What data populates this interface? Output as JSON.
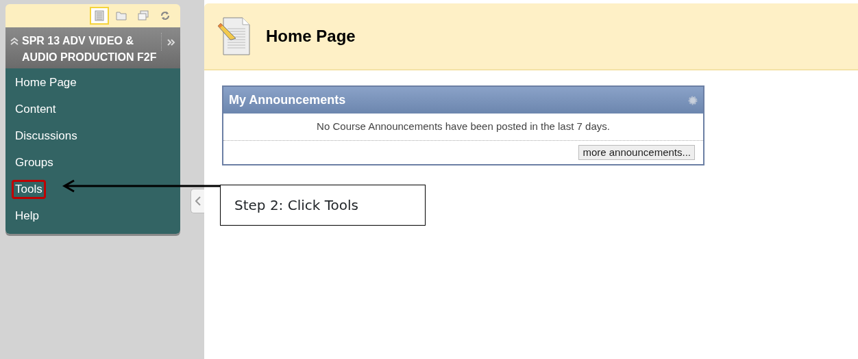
{
  "sidebar": {
    "view_buttons": [
      {
        "kind": "list",
        "selected": true
      },
      {
        "kind": "folder",
        "selected": false
      },
      {
        "kind": "windows",
        "selected": false
      },
      {
        "kind": "refresh",
        "selected": false
      }
    ],
    "course_title": "SPR 13 ADV VIDEO & AUDIO PRODUCTION F2F",
    "menu_items": [
      {
        "label": "Home Page",
        "highlighted": false
      },
      {
        "label": "Content",
        "highlighted": false
      },
      {
        "label": "Discussions",
        "highlighted": false
      },
      {
        "label": "Groups",
        "highlighted": false
      },
      {
        "label": "Tools",
        "highlighted": true
      },
      {
        "label": "Help",
        "highlighted": false
      }
    ]
  },
  "page": {
    "title": "Home Page"
  },
  "module": {
    "title": "My Announcements",
    "message": "No Course Announcements have been posted in the last 7 days.",
    "more_button": "more announcements..."
  },
  "callout": {
    "text": "Step 2: Click Tools"
  }
}
